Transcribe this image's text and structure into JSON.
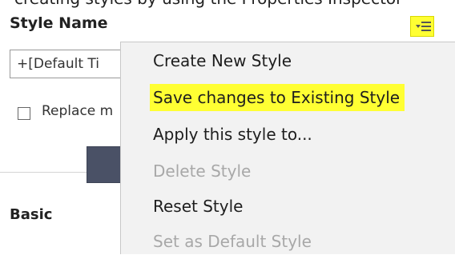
{
  "panel": {
    "top_text": "creating styles by using the Properties Inspector",
    "style_name_label": "Style Name",
    "style_field_value": "+[Default Ti",
    "replace_label": "Replace m",
    "basic_label": "Basic"
  },
  "menu": {
    "items": [
      {
        "label": "Create New Style",
        "enabled": true
      },
      {
        "label": "Save changes to Existing Style",
        "enabled": true,
        "highlighted": true
      },
      {
        "label": "Apply this style to...",
        "enabled": true
      },
      {
        "label": "Delete Style",
        "enabled": false
      },
      {
        "label": "Reset Style",
        "enabled": true
      },
      {
        "label": "Set as Default Style",
        "enabled": false
      }
    ]
  },
  "colors": {
    "highlight": "#ffff33",
    "swatch": "#4a5166",
    "menu_bg": "#f2f2f2",
    "disabled_text": "#a8a8a8"
  },
  "icons": {
    "style_menu_button": "list-menu-icon"
  }
}
